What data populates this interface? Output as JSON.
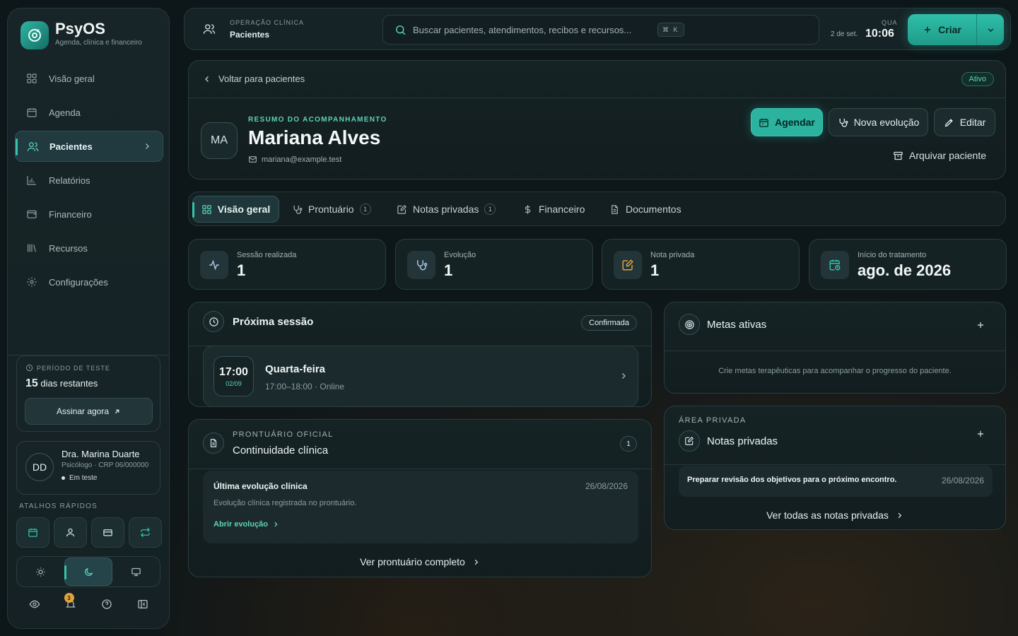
{
  "brand": {
    "name": "PsyOS",
    "subtitle": "Agenda, clínica e financeiro",
    "accent": "#2fbfa9"
  },
  "nav": [
    {
      "label": "Visão geral",
      "icon": "grid-icon"
    },
    {
      "label": "Agenda",
      "icon": "calendar-icon"
    },
    {
      "label": "Pacientes",
      "icon": "users-icon",
      "active": true
    },
    {
      "label": "Relatórios",
      "icon": "bar-chart-icon"
    },
    {
      "label": "Financeiro",
      "icon": "wallet-icon"
    },
    {
      "label": "Recursos",
      "icon": "library-icon"
    },
    {
      "label": "Configurações",
      "icon": "gear-icon"
    }
  ],
  "trial": {
    "label": "PERÍODO DE TESTE",
    "days": "15",
    "days_suffix": " dias restantes",
    "cta": "Assinar agora"
  },
  "user": {
    "initials": "DD",
    "name": "Dra. Marina Duarte",
    "role": "Psicólogo · CRP 06/000000",
    "status": "Em teste"
  },
  "quick": {
    "label": "ATALHOS RÁPIDOS"
  },
  "notifications": {
    "count": "3"
  },
  "topbar": {
    "overline": "OPERAÇÃO CLÍNICA",
    "title": "Pacientes",
    "search_placeholder": "Buscar pacientes, atendimentos, recibos e recursos...",
    "shortcut": "⌘ K",
    "weekday": "QUA",
    "date": "2 de set.",
    "time": "10:06",
    "create": "Criar"
  },
  "patient": {
    "back": "Voltar para pacientes",
    "status": "Ativo",
    "initials": "MA",
    "overline": "RESUMO DO ACOMPANHAMENTO",
    "name": "Mariana Alves",
    "email": "mariana@example.test",
    "actions": {
      "schedule": "Agendar",
      "new_evolution": "Nova evolução",
      "edit": "Editar",
      "archive": "Arquivar paciente"
    }
  },
  "tabs": [
    {
      "label": "Visão geral",
      "icon": "grid-icon",
      "active": true
    },
    {
      "label": "Prontuário",
      "icon": "stethoscope-icon",
      "count": "1"
    },
    {
      "label": "Notas privadas",
      "icon": "note-edit-icon",
      "count": "1"
    },
    {
      "label": "Financeiro",
      "icon": "dollar-icon"
    },
    {
      "label": "Documentos",
      "icon": "document-icon"
    }
  ],
  "stats": [
    {
      "label": "Sessão realizada",
      "value": "1",
      "icon": "activity-icon"
    },
    {
      "label": "Evolução",
      "value": "1",
      "icon": "stethoscope-icon"
    },
    {
      "label": "Nota privada",
      "value": "1",
      "icon": "note-edit-icon",
      "color": "#e0a33d"
    },
    {
      "label": "Início do tratamento",
      "value": "ago. de 2026",
      "icon": "calendar-clock-icon",
      "color": "#2fbfa9"
    }
  ],
  "next_session": {
    "title": "Próxima sessão",
    "status": "Confirmada",
    "time": "17:00",
    "date": "02/09",
    "day": "Quarta-feira",
    "range": "17:00–18:00 · Online"
  },
  "record": {
    "overline": "PRONTUÁRIO OFICIAL",
    "title": "Continuidade clínica",
    "count": "1",
    "last_title": "Última evolução clínica",
    "last_date": "26/08/2026",
    "last_desc": "Evolução clínica registrada no prontuário.",
    "open": "Abrir evolução",
    "see_all": "Ver prontuário completo"
  },
  "goals": {
    "title": "Metas ativas",
    "empty": "Crie metas terapêuticas para acompanhar o progresso do paciente."
  },
  "private_notes": {
    "overline": "ÁREA PRIVADA",
    "title": "Notas privadas",
    "note": "Preparar revisão dos objetivos para o próximo encontro.",
    "note_date": "26/08/2026",
    "see_all": "Ver todas as notas privadas"
  }
}
